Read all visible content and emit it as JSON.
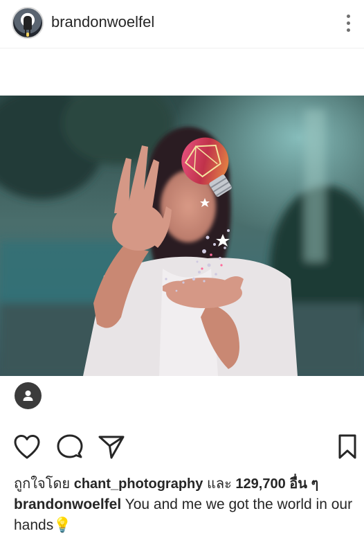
{
  "header": {
    "username": "brandonwoelfel",
    "avatar_icon": "profile-avatar",
    "more_icon": "more-options-icon"
  },
  "post": {
    "image_icon": "post-photo",
    "user_tag_icon": "user-tag-icon"
  },
  "actions": {
    "like_icon": "heart-icon",
    "comment_icon": "comment-icon",
    "share_icon": "paper-plane-icon",
    "save_icon": "bookmark-icon"
  },
  "likes": {
    "prefix": "ถูกใจโดย",
    "liker": "chant_photography",
    "conjunction": "และ",
    "count_text": "129,700 อื่น ๆ"
  },
  "caption": {
    "author": "brandonwoelfel",
    "text": " You and me we got the world in our hands",
    "emoji": "💡"
  },
  "colors": {
    "text": "#262626",
    "divider": "#efefef",
    "icon": "#262626"
  }
}
